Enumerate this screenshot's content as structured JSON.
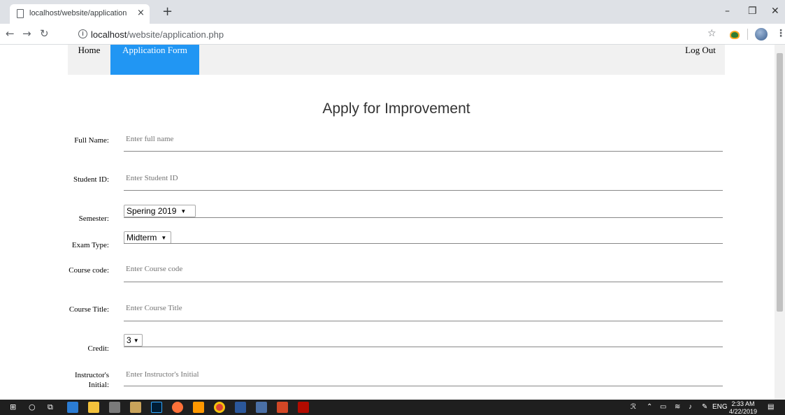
{
  "browser": {
    "tab_title": "localhost/website/application.php",
    "tab_close": "×",
    "new_tab": "+",
    "url_host": "localhost",
    "url_path": "/website/application.php",
    "window_controls": [
      "–",
      "❐",
      "✕"
    ]
  },
  "nav": {
    "home": "Home",
    "application_form": "Application Form",
    "logout": "Log Out",
    "active_color": "#2196f3"
  },
  "page": {
    "title": "Apply for Improvement"
  },
  "form": {
    "full_name": {
      "label": "Full Name:",
      "placeholder": "Enter full name"
    },
    "student_id": {
      "label": "Student ID:",
      "placeholder": "Enter Student ID"
    },
    "semester": {
      "label": "Semester:",
      "value": "Spering 2019"
    },
    "exam_type": {
      "label": "Exam Type:",
      "value": "Midterm"
    },
    "course_code": {
      "label": "Course code:",
      "placeholder": "Enter Course code"
    },
    "course_title": {
      "label": "Course Title:",
      "placeholder": "Enter Course Title"
    },
    "credit": {
      "label": "Credit:",
      "value": "3"
    },
    "instructor_initial": {
      "label_line1": "Instructor's",
      "label_line2": "Initial:",
      "placeholder": "Enter Instructor's Initial"
    }
  },
  "taskbar": {
    "language": "ENG",
    "time": "2:33 AM",
    "date": "4/22/2019"
  }
}
